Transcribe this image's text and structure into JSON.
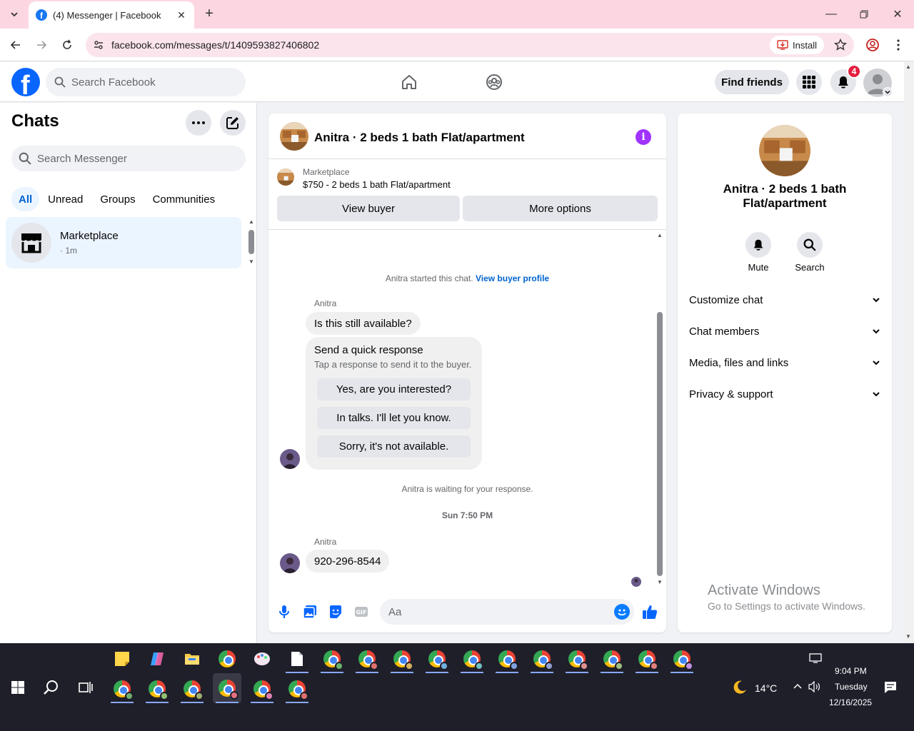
{
  "browser": {
    "tab_title": "(4) Messenger | Facebook",
    "url": "facebook.com/messages/t/1409593827406802",
    "install_label": "Install"
  },
  "header": {
    "search_placeholder": "Search Facebook",
    "find_friends": "Find friends",
    "notification_count": "4"
  },
  "sidebar": {
    "title": "Chats",
    "search_placeholder": "Search Messenger",
    "filters": [
      "All",
      "Unread",
      "Groups",
      "Communities"
    ],
    "chats": [
      {
        "name": "Marketplace",
        "time": "· 1m"
      }
    ]
  },
  "chat": {
    "title": "Anitra · 2 beds 1 bath Flat/apartment",
    "marketplace_label": "Marketplace",
    "listing": "$750 - 2 beds 1 bath Flat/apartment",
    "view_buyer": "View buyer",
    "more_options": "More options",
    "started_text": "Anitra started this chat.",
    "view_buyer_profile": "View buyer profile",
    "sender_name": "Anitra",
    "message_1": "Is this still available?",
    "quick_response_title": "Send a quick response",
    "quick_response_sub": "Tap a response to send it to the buyer.",
    "quick_responses": [
      "Yes, are you interested?",
      "In talks. I'll let you know.",
      "Sorry, it's not available."
    ],
    "waiting_text": "Anitra is waiting for your response.",
    "timestamp": "Sun 7:50 PM",
    "message_2": "920-296-8544",
    "composer_placeholder": "Aa"
  },
  "info_panel": {
    "name": "Anitra · 2 beds 1 bath Flat/apartment",
    "mute": "Mute",
    "search": "Search",
    "rows": [
      "Customize chat",
      "Chat members",
      "Media, files and links",
      "Privacy & support"
    ],
    "activate_title": "Activate Windows",
    "activate_sub": "Go to Settings to activate Windows."
  },
  "taskbar": {
    "temperature": "14°C",
    "time": "9:04 PM",
    "day": "Tuesday",
    "date": "12/16/2025"
  },
  "colors": {
    "accent": "#0866ff",
    "link": "#0064d1",
    "badge": "#e41e3f",
    "info": "#a033ff",
    "tabbar": "#fcd7e2"
  }
}
